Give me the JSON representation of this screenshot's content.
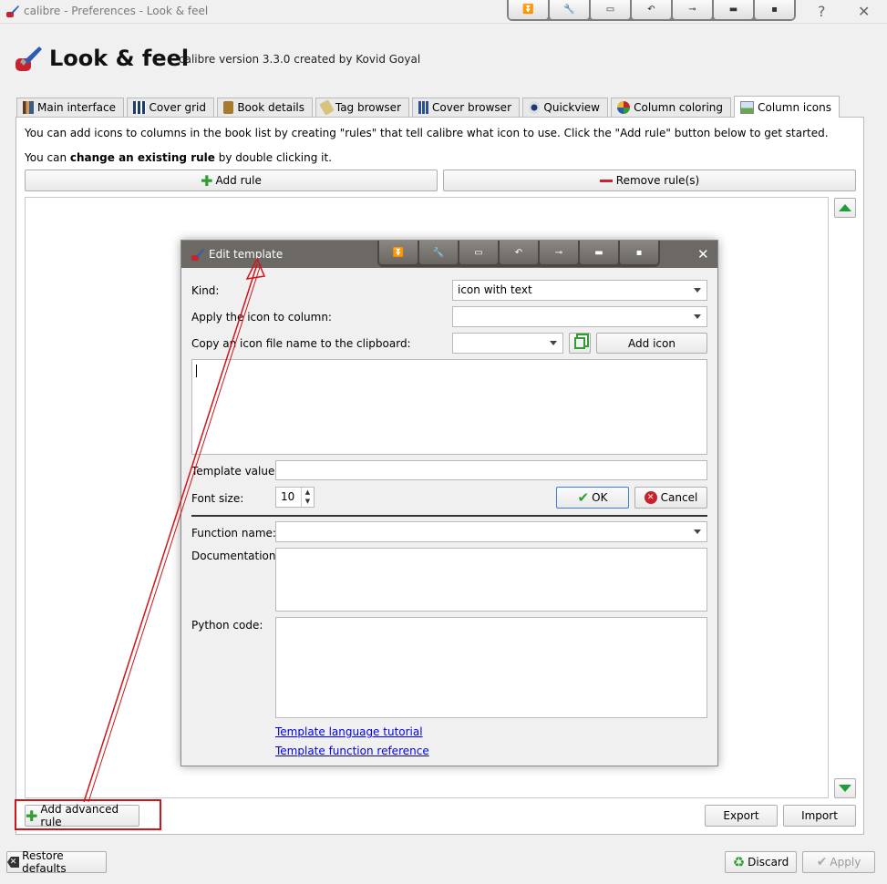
{
  "window": {
    "title": "calibre - Preferences - Look & feel",
    "help": "?",
    "close": "✕"
  },
  "header": {
    "title": "Look & feel",
    "subtitle": "calibre version 3.3.0 created by Kovid Goyal"
  },
  "tabs": [
    {
      "label": "Main interface"
    },
    {
      "label": "Cover grid"
    },
    {
      "label": "Book details"
    },
    {
      "label": "Tag browser"
    },
    {
      "label": "Cover browser"
    },
    {
      "label": "Quickview"
    },
    {
      "label": "Column coloring"
    },
    {
      "label": "Column icons",
      "active": true
    }
  ],
  "intro": {
    "line1": "You can add icons to columns in the book list by creating \"rules\" that tell calibre what icon to use. Click the \"Add rule\" button below to get started.",
    "line2_prefix": "You can ",
    "line2_bold": "change an existing rule",
    "line2_suffix": " by double clicking it."
  },
  "buttons": {
    "add_rule": "Add rule",
    "remove_rule": "Remove rule(s)",
    "add_advanced_rule": "Add advanced rule",
    "export": "Export",
    "import": "Import",
    "restore_defaults": "Restore defaults",
    "discard": "Discard",
    "apply": "Apply"
  },
  "dialog": {
    "title": "Edit template",
    "kind_label": "Kind:",
    "kind_value": "icon with text",
    "apply_label": "Apply the icon to column:",
    "apply_value": "",
    "copy_label": "Copy an icon file name to the clipboard:",
    "copy_value": "",
    "add_icon": "Add icon",
    "template_value_label": "Template value:",
    "font_size_label": "Font size:",
    "font_size_value": "10",
    "ok": "OK",
    "cancel": "Cancel",
    "function_name_label": "Function name:",
    "documentation_label": "Documentation:",
    "python_code_label": "Python code:",
    "tutorial_link": "Template language tutorial",
    "reference_link": "Template function reference"
  },
  "colors": {
    "accent_red": "#d0141a",
    "green": "#2e9e2e",
    "link": "#0000ee",
    "dialog_titlebar": "#6c6864"
  }
}
